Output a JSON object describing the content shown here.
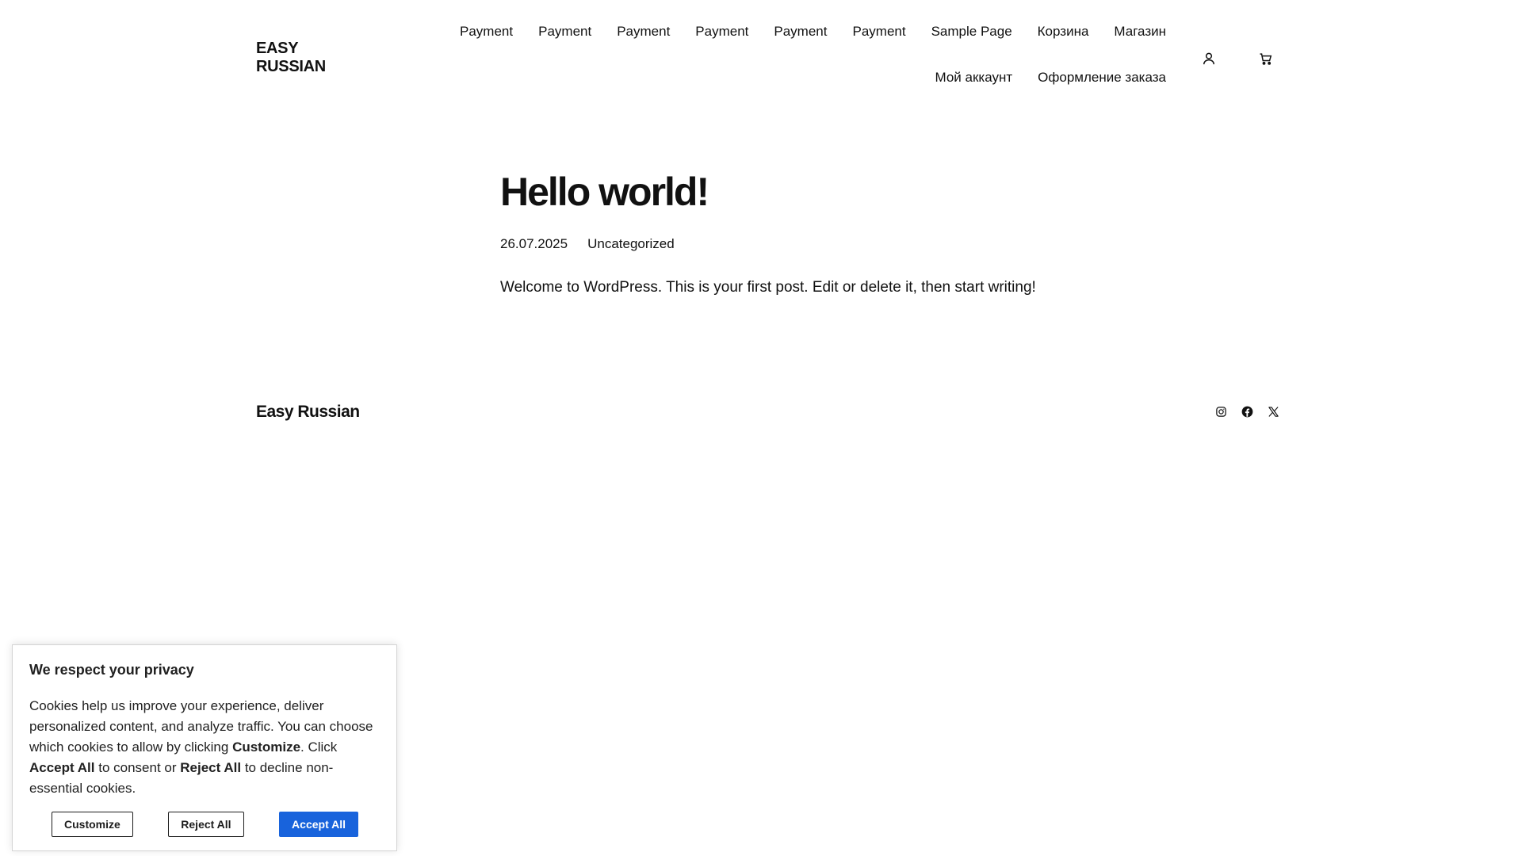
{
  "header": {
    "site_title": "EASY RUSSIAN",
    "nav_items": [
      "Payment",
      "Payment",
      "Payment",
      "Payment",
      "Payment",
      "Payment",
      "Sample Page",
      "Корзина",
      "Магазин",
      "Мой аккаунт",
      "Оформление заказа"
    ],
    "icons": [
      "account-icon",
      "cart-icon"
    ]
  },
  "post": {
    "title": "Hello world!",
    "date": "26.07.2025",
    "category": "Uncategorized",
    "content": "Welcome to WordPress. This is your first post. Edit or delete it, then start writing!"
  },
  "footer": {
    "site_title": "Easy Russian",
    "social_icons": [
      "instagram-icon",
      "facebook-icon",
      "x-icon"
    ]
  },
  "cookie_banner": {
    "title": "We respect your privacy",
    "text_1": "Cookies help us improve your experience, deliver personalized content, and analyze traffic. You can choose which cookies to allow by clicking ",
    "bold_customize": "Customize",
    "text_2": ". Click ",
    "bold_accept": "Accept All",
    "text_3": " to consent or ",
    "bold_reject": "Reject All",
    "text_4": " to decline non-essential cookies.",
    "customize_label": "Customize",
    "reject_label": "Reject All",
    "accept_label": "Accept All",
    "accent_color": "#1863dc"
  }
}
